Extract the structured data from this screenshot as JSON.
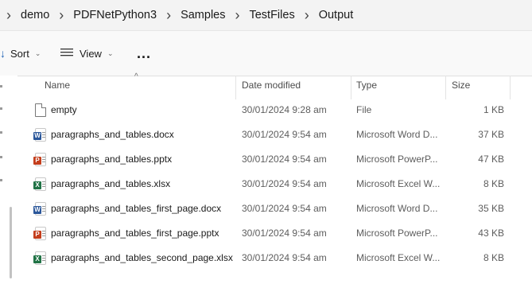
{
  "breadcrumb": [
    "demo",
    "PDFNetPython3",
    "Samples",
    "TestFiles",
    "Output"
  ],
  "commandbar": {
    "sort_label": "Sort",
    "view_label": "View",
    "more_label": "..."
  },
  "columns": {
    "name": "Name",
    "date": "Date modified",
    "type": "Type",
    "size": "Size"
  },
  "colors": {
    "word": "#2b579a",
    "powerpoint": "#c43e1c",
    "excel": "#217346"
  },
  "files": [
    {
      "name": "empty",
      "date": "30/01/2024 9:28 am",
      "type": "File",
      "size": "1 KB",
      "icon": "blank-file-icon"
    },
    {
      "name": "paragraphs_and_tables.docx",
      "date": "30/01/2024 9:54 am",
      "type": "Microsoft Word D...",
      "size": "37 KB",
      "icon": "word-document-icon"
    },
    {
      "name": "paragraphs_and_tables.pptx",
      "date": "30/01/2024 9:54 am",
      "type": "Microsoft PowerP...",
      "size": "47 KB",
      "icon": "powerpoint-document-icon"
    },
    {
      "name": "paragraphs_and_tables.xlsx",
      "date": "30/01/2024 9:54 am",
      "type": "Microsoft Excel W...",
      "size": "8 KB",
      "icon": "excel-document-icon"
    },
    {
      "name": "paragraphs_and_tables_first_page.docx",
      "date": "30/01/2024 9:54 am",
      "type": "Microsoft Word D...",
      "size": "35 KB",
      "icon": "word-document-icon"
    },
    {
      "name": "paragraphs_and_tables_first_page.pptx",
      "date": "30/01/2024 9:54 am",
      "type": "Microsoft PowerP...",
      "size": "43 KB",
      "icon": "powerpoint-document-icon"
    },
    {
      "name": "paragraphs_and_tables_second_page.xlsx",
      "date": "30/01/2024 9:54 am",
      "type": "Microsoft Excel W...",
      "size": "8 KB",
      "icon": "excel-document-icon"
    }
  ]
}
